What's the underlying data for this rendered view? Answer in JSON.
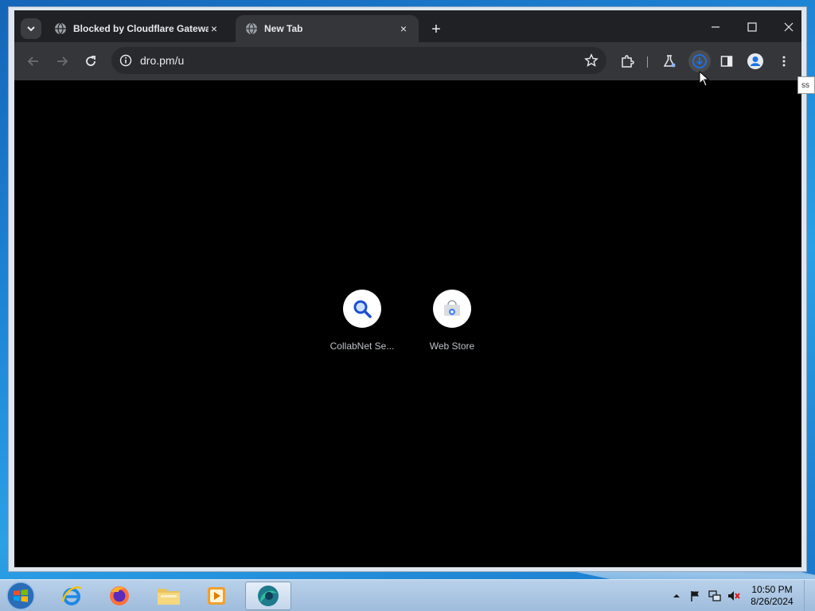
{
  "browser": {
    "tabs": [
      {
        "title": "Blocked by Cloudflare Gateway",
        "active": false
      },
      {
        "title": "New Tab",
        "active": true
      }
    ],
    "close_symbol": "×",
    "new_tab_symbol": "+",
    "address": {
      "url": "dro.pm/u"
    }
  },
  "tooltip": {
    "text": "ss"
  },
  "shortcuts": [
    {
      "label": "CollabNet Se...",
      "icon": "search-icon"
    },
    {
      "label": "Web Store",
      "icon": "web-store-icon"
    }
  ],
  "taskbar": {
    "apps": [
      "internet-explorer-icon",
      "firefox-icon",
      "file-explorer-icon",
      "media-player-icon",
      "chromium-browser-icon"
    ],
    "active_app": "chromium-browser-icon"
  },
  "clock": {
    "time": "10:50 PM",
    "date": "8/26/2024"
  },
  "colors": {
    "titlebar": "#202124",
    "toolbar": "#35363a",
    "omnibox": "#282a2d",
    "accent_blue": "#1a73e8",
    "taskbar": "#b9d1ea"
  }
}
